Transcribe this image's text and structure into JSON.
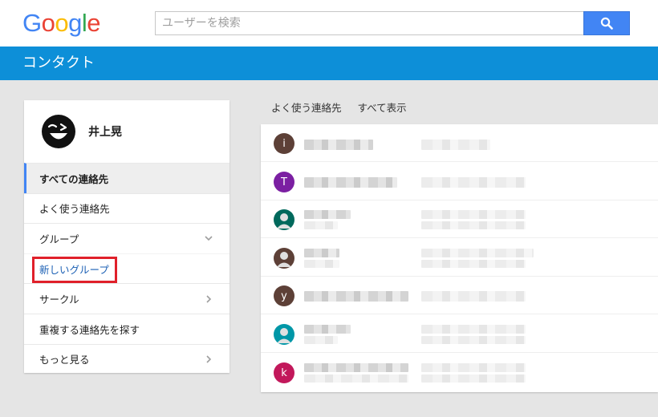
{
  "header": {
    "logo_letters": [
      {
        "ch": "G",
        "color": "#4285f4"
      },
      {
        "ch": "o",
        "color": "#ea4335"
      },
      {
        "ch": "o",
        "color": "#fbbc05"
      },
      {
        "ch": "g",
        "color": "#4285f4"
      },
      {
        "ch": "l",
        "color": "#34a853"
      },
      {
        "ch": "e",
        "color": "#ea4335"
      }
    ],
    "search_placeholder": "ユーザーを検索",
    "search_icon": "search-icon"
  },
  "appbar": {
    "title": "コンタクト"
  },
  "sidebar": {
    "profile_name": "井上晃",
    "items": [
      {
        "label": "すべての連絡先",
        "active": true
      },
      {
        "label": "よく使う連絡先"
      },
      {
        "label": "グループ",
        "icon": "chevron-down-icon"
      },
      {
        "label": "新しいグループ"
      },
      {
        "label": "サークル",
        "icon": "chevron-right-icon"
      },
      {
        "label": "重複する連絡先を探す"
      },
      {
        "label": "もっと見る",
        "icon": "chevron-right-icon"
      }
    ]
  },
  "main": {
    "tabs": [
      {
        "label": "よく使う連絡先"
      },
      {
        "label": "すべて表示"
      }
    ],
    "contacts": [
      {
        "initial": "i",
        "color": "#5d4037"
      },
      {
        "initial": "T",
        "color": "#7b1fa2"
      },
      {
        "initial": "",
        "color": "#00695c"
      },
      {
        "initial": "",
        "color": "#5d4037"
      },
      {
        "initial": "y",
        "color": "#5d4037"
      },
      {
        "initial": "",
        "color": "#0097a7"
      },
      {
        "initial": "k",
        "color": "#c2185b"
      }
    ]
  },
  "colors": {
    "accent_blue": "#0d8fd8",
    "search_button": "#4285f4",
    "highlight_red": "#e0202a"
  }
}
